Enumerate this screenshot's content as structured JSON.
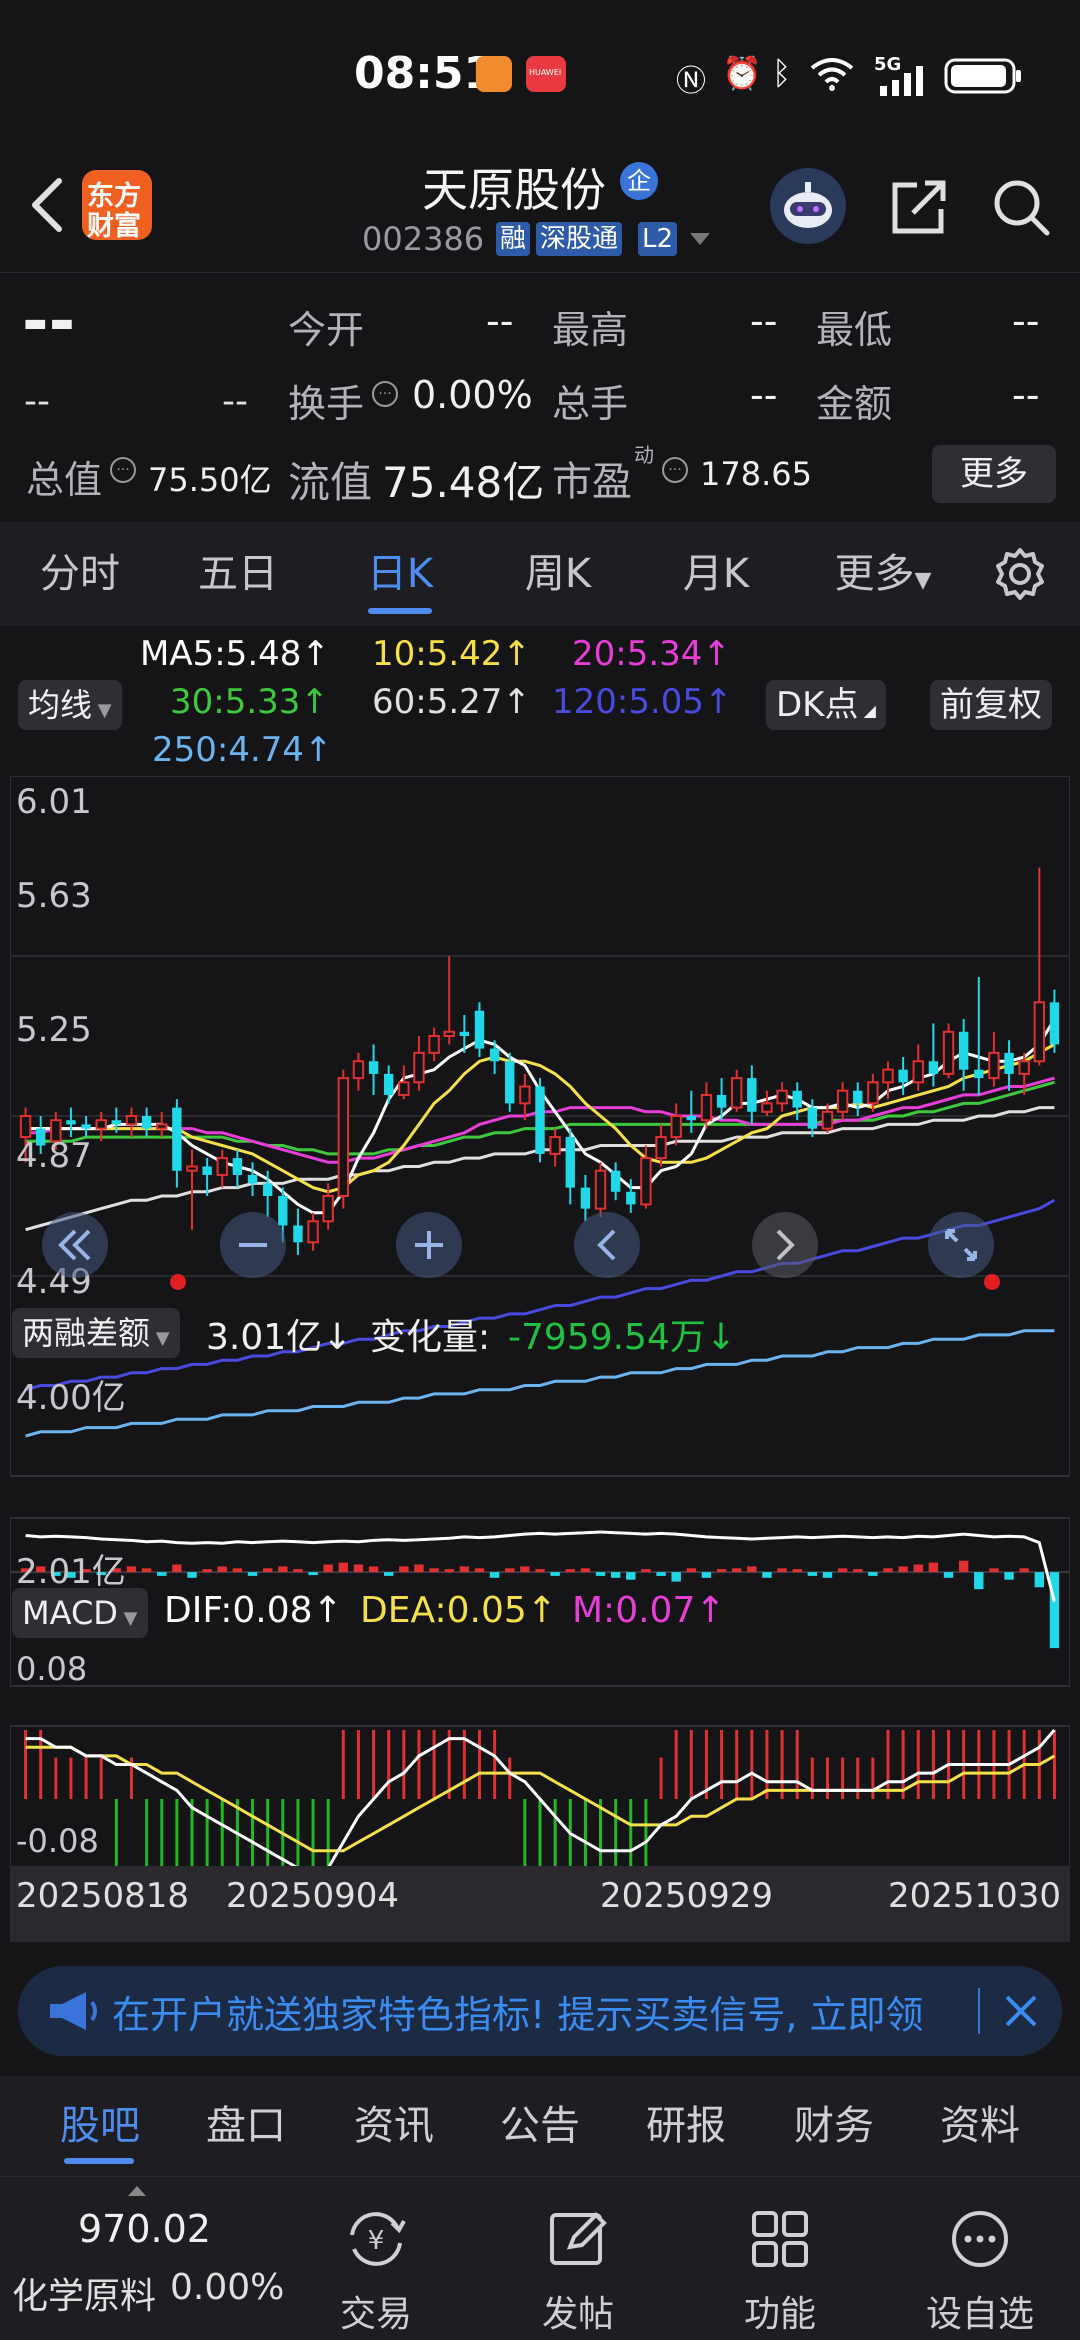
{
  "status_bar": {
    "time": "08:51",
    "network": "5G",
    "huawei_label": "HUAWEI"
  },
  "header": {
    "logo_text_line1": "东方",
    "logo_text_line2": "财富",
    "stock_name": "天原股份",
    "enterprise_badge": "企",
    "stock_code": "002386",
    "badge_margin": "融",
    "badge_connect": "深股通",
    "badge_level": "L2"
  },
  "quote": {
    "price": "--",
    "change": "--",
    "change_pct": "--",
    "open_label": "今开",
    "open_value": "--",
    "high_label": "最高",
    "high_value": "--",
    "low_label": "最低",
    "low_value": "--",
    "turnover_label": "换手",
    "turnover_value": "0.00%",
    "volume_label": "总手",
    "volume_value": "--",
    "amount_label": "金额",
    "amount_value": "--",
    "total_value_label": "总值",
    "total_value": "75.50亿",
    "float_value_label": "流值",
    "float_value": "75.48亿",
    "pe_label": "市盈",
    "pe_sup": "动",
    "pe_value": "178.65",
    "more_button": "更多"
  },
  "period_tabs": [
    "分时",
    "五日",
    "日K",
    "周K",
    "月K",
    "更多"
  ],
  "active_period": 2,
  "indicators": {
    "ma_selector": "均线",
    "ma5": "MA5:5.48",
    "ma10": "10:5.42",
    "ma20": "20:5.34",
    "ma30": "30:5.33",
    "ma60": "60:5.27",
    "ma120": "120:5.05",
    "ma250": "250:4.74",
    "dk_button": "DK点",
    "adjust_button": "前复权",
    "colors": {
      "ma5": "#ffffff",
      "ma10": "#f5e04a",
      "ma20": "#e83ed8",
      "ma30": "#3ec83e",
      "ma60": "#e0e0e0",
      "ma120": "#4a4ae0",
      "ma250": "#6cb4f0",
      "up": "#e03030",
      "down": "#20d8e8"
    }
  },
  "price_axis": {
    "y_max": "6.01",
    "y2": "5.63",
    "y3": "5.25",
    "y4": "4.87",
    "y_min": "4.49"
  },
  "margin_panel": {
    "selector": "两融差额",
    "value": "3.01亿",
    "change_label": "变化量:",
    "change_value": "-7959.54万",
    "axis_top": "4.00亿",
    "axis_bottom": "2.01亿"
  },
  "macd_panel": {
    "selector": "MACD",
    "dif": "DIF:0.08",
    "dea": "DEA:0.05",
    "m": "M:0.07",
    "axis_top": "0.08",
    "axis_bottom": "-0.08"
  },
  "dates": [
    "20250818",
    "20250904",
    "20250929",
    "20251030"
  ],
  "chart_data": {
    "type": "candlestick",
    "ylim": [
      4.49,
      6.01
    ],
    "candles": [
      [
        5.2,
        5.25,
        5.14,
        5.27
      ],
      [
        5.22,
        5.18,
        5.16,
        5.25
      ],
      [
        5.19,
        5.24,
        5.17,
        5.26
      ],
      [
        5.24,
        5.23,
        5.2,
        5.27
      ],
      [
        5.23,
        5.22,
        5.2,
        5.25
      ],
      [
        5.22,
        5.24,
        5.19,
        5.26
      ],
      [
        5.24,
        5.23,
        5.21,
        5.27
      ],
      [
        5.23,
        5.25,
        5.2,
        5.27
      ],
      [
        5.25,
        5.22,
        5.2,
        5.27
      ],
      [
        5.22,
        5.23,
        5.2,
        5.26
      ],
      [
        5.27,
        5.12,
        5.08,
        5.29
      ],
      [
        5.12,
        5.13,
        4.98,
        5.17
      ],
      [
        5.13,
        5.11,
        5.06,
        5.15
      ],
      [
        5.11,
        5.15,
        5.08,
        5.17
      ],
      [
        5.15,
        5.11,
        5.08,
        5.17
      ],
      [
        5.11,
        5.09,
        5.06,
        5.14
      ],
      [
        5.09,
        5.06,
        5.01,
        5.12
      ],
      [
        5.06,
        4.99,
        4.95,
        5.08
      ],
      [
        4.99,
        4.95,
        4.92,
        5.03
      ],
      [
        4.95,
        5.0,
        4.93,
        5.02
      ],
      [
        5.0,
        5.06,
        4.98,
        5.09
      ],
      [
        5.06,
        5.34,
        5.03,
        5.36
      ],
      [
        5.34,
        5.38,
        5.31,
        5.4
      ],
      [
        5.38,
        5.35,
        5.3,
        5.42
      ],
      [
        5.35,
        5.3,
        5.28,
        5.37
      ],
      [
        5.3,
        5.33,
        5.29,
        5.37
      ],
      [
        5.33,
        5.4,
        5.31,
        5.44
      ],
      [
        5.4,
        5.44,
        5.38,
        5.46
      ],
      [
        5.44,
        5.45,
        5.42,
        5.63
      ],
      [
        5.45,
        5.44,
        5.4,
        5.49
      ],
      [
        5.5,
        5.41,
        5.39,
        5.52
      ],
      [
        5.41,
        5.38,
        5.35,
        5.43
      ],
      [
        5.38,
        5.28,
        5.26,
        5.4
      ],
      [
        5.28,
        5.32,
        5.24,
        5.35
      ],
      [
        5.32,
        5.16,
        5.14,
        5.34
      ],
      [
        5.16,
        5.2,
        5.13,
        5.22
      ],
      [
        5.2,
        5.08,
        5.04,
        5.22
      ],
      [
        5.08,
        5.03,
        5.0,
        5.11
      ],
      [
        5.03,
        5.12,
        5.01,
        5.14
      ],
      [
        5.12,
        5.07,
        5.05,
        5.14
      ],
      [
        5.07,
        5.04,
        5.02,
        5.1
      ],
      [
        5.04,
        5.15,
        5.03,
        5.18
      ],
      [
        5.15,
        5.2,
        5.13,
        5.23
      ],
      [
        5.2,
        5.25,
        5.18,
        5.28
      ],
      [
        5.25,
        5.24,
        5.21,
        5.31
      ],
      [
        5.24,
        5.3,
        5.22,
        5.33
      ],
      [
        5.3,
        5.27,
        5.24,
        5.34
      ],
      [
        5.27,
        5.34,
        5.26,
        5.36
      ],
      [
        5.34,
        5.26,
        5.23,
        5.37
      ],
      [
        5.26,
        5.28,
        5.25,
        5.31
      ],
      [
        5.28,
        5.31,
        5.26,
        5.33
      ],
      [
        5.31,
        5.27,
        5.24,
        5.33
      ],
      [
        5.27,
        5.22,
        5.2,
        5.29
      ],
      [
        5.22,
        5.26,
        5.21,
        5.28
      ],
      [
        5.26,
        5.31,
        5.24,
        5.33
      ],
      [
        5.31,
        5.28,
        5.25,
        5.33
      ],
      [
        5.28,
        5.33,
        5.26,
        5.35
      ],
      [
        5.33,
        5.36,
        5.29,
        5.38
      ],
      [
        5.36,
        5.33,
        5.3,
        5.39
      ],
      [
        5.33,
        5.38,
        5.31,
        5.42
      ],
      [
        5.38,
        5.35,
        5.32,
        5.47
      ],
      [
        5.35,
        5.45,
        5.34,
        5.47
      ],
      [
        5.45,
        5.36,
        5.31,
        5.48
      ],
      [
        5.36,
        5.34,
        5.3,
        5.58
      ],
      [
        5.34,
        5.4,
        5.32,
        5.45
      ],
      [
        5.4,
        5.35,
        5.31,
        5.43
      ],
      [
        5.35,
        5.38,
        5.3,
        5.4
      ],
      [
        5.38,
        5.52,
        5.37,
        5.84
      ],
      [
        5.52,
        5.42,
        5.4,
        5.55
      ]
    ],
    "ma": {
      "ma5": [
        5.22,
        5.22,
        5.22,
        5.22,
        5.22,
        5.22,
        5.23,
        5.23,
        5.23,
        5.23,
        5.21,
        5.18,
        5.16,
        5.14,
        5.13,
        5.12,
        5.1,
        5.07,
        5.04,
        5.02,
        5.02,
        5.07,
        5.15,
        5.21,
        5.29,
        5.34,
        5.35,
        5.36,
        5.39,
        5.41,
        5.43,
        5.42,
        5.39,
        5.37,
        5.31,
        5.26,
        5.21,
        5.16,
        5.14,
        5.11,
        5.08,
        5.08,
        5.12,
        5.13,
        5.16,
        5.23,
        5.25,
        5.28,
        5.28,
        5.29,
        5.3,
        5.29,
        5.27,
        5.27,
        5.28,
        5.27,
        5.28,
        5.31,
        5.32,
        5.34,
        5.35,
        5.38,
        5.4,
        5.39,
        5.38,
        5.38,
        5.39,
        5.42,
        5.48
      ],
      "ma10": [
        5.22,
        5.22,
        5.22,
        5.22,
        5.22,
        5.22,
        5.22,
        5.22,
        5.22,
        5.22,
        5.22,
        5.2,
        5.19,
        5.18,
        5.17,
        5.16,
        5.14,
        5.12,
        5.1,
        5.08,
        5.07,
        5.08,
        5.11,
        5.12,
        5.14,
        5.18,
        5.23,
        5.28,
        5.31,
        5.35,
        5.38,
        5.39,
        5.38,
        5.38,
        5.37,
        5.35,
        5.32,
        5.28,
        5.25,
        5.22,
        5.18,
        5.15,
        5.14,
        5.14,
        5.14,
        5.15,
        5.17,
        5.19,
        5.21,
        5.22,
        5.25,
        5.26,
        5.27,
        5.27,
        5.27,
        5.28,
        5.27,
        5.28,
        5.29,
        5.3,
        5.31,
        5.32,
        5.34,
        5.35,
        5.36,
        5.37,
        5.38,
        5.4,
        5.42
      ],
      "ma20": [
        5.21,
        5.21,
        5.22,
        5.22,
        5.22,
        5.22,
        5.22,
        5.22,
        5.22,
        5.22,
        5.22,
        5.22,
        5.21,
        5.21,
        5.2,
        5.19,
        5.18,
        5.17,
        5.16,
        5.15,
        5.14,
        5.14,
        5.15,
        5.15,
        5.16,
        5.17,
        5.18,
        5.19,
        5.2,
        5.21,
        5.23,
        5.24,
        5.25,
        5.25,
        5.26,
        5.26,
        5.27,
        5.27,
        5.27,
        5.27,
        5.27,
        5.26,
        5.26,
        5.25,
        5.25,
        5.25,
        5.24,
        5.24,
        5.23,
        5.23,
        5.23,
        5.23,
        5.23,
        5.23,
        5.24,
        5.24,
        5.25,
        5.26,
        5.27,
        5.27,
        5.28,
        5.29,
        5.3,
        5.3,
        5.31,
        5.32,
        5.32,
        5.33,
        5.34
      ],
      "ma30": [
        5.19,
        5.19,
        5.19,
        5.19,
        5.2,
        5.2,
        5.2,
        5.2,
        5.2,
        5.2,
        5.2,
        5.2,
        5.2,
        5.2,
        5.19,
        5.19,
        5.18,
        5.18,
        5.17,
        5.17,
        5.16,
        5.16,
        5.16,
        5.16,
        5.17,
        5.17,
        5.18,
        5.18,
        5.19,
        5.2,
        5.2,
        5.21,
        5.21,
        5.22,
        5.22,
        5.22,
        5.23,
        5.23,
        5.23,
        5.23,
        5.23,
        5.23,
        5.23,
        5.23,
        5.23,
        5.23,
        5.23,
        5.23,
        5.23,
        5.23,
        5.23,
        5.23,
        5.23,
        5.24,
        5.24,
        5.24,
        5.24,
        5.25,
        5.25,
        5.26,
        5.26,
        5.27,
        5.28,
        5.28,
        5.29,
        5.3,
        5.31,
        5.32,
        5.33
      ],
      "ma60": [
        4.98,
        4.99,
        5.0,
        5.01,
        5.02,
        5.03,
        5.04,
        5.05,
        5.05,
        5.06,
        5.06,
        5.07,
        5.07,
        5.08,
        5.08,
        5.09,
        5.09,
        5.09,
        5.1,
        5.1,
        5.1,
        5.11,
        5.11,
        5.12,
        5.12,
        5.13,
        5.13,
        5.14,
        5.14,
        5.15,
        5.15,
        5.16,
        5.16,
        5.16,
        5.17,
        5.17,
        5.17,
        5.17,
        5.18,
        5.18,
        5.18,
        5.18,
        5.18,
        5.19,
        5.19,
        5.19,
        5.19,
        5.2,
        5.2,
        5.2,
        5.21,
        5.21,
        5.21,
        5.21,
        5.22,
        5.22,
        5.22,
        5.23,
        5.23,
        5.23,
        5.24,
        5.24,
        5.24,
        5.25,
        5.25,
        5.26,
        5.26,
        5.27,
        5.27
      ],
      "ma120": [
        4.6,
        4.61,
        4.61,
        4.62,
        4.62,
        4.63,
        4.63,
        4.64,
        4.64,
        4.65,
        4.65,
        4.66,
        4.66,
        4.67,
        4.67,
        4.68,
        4.68,
        4.69,
        4.69,
        4.7,
        4.71,
        4.71,
        4.72,
        4.72,
        4.73,
        4.74,
        4.74,
        4.75,
        4.75,
        4.76,
        4.77,
        4.77,
        4.78,
        4.78,
        4.79,
        4.8,
        4.8,
        4.81,
        4.82,
        4.82,
        4.83,
        4.84,
        4.84,
        4.85,
        4.86,
        4.86,
        4.87,
        4.88,
        4.88,
        4.89,
        4.9,
        4.9,
        4.91,
        4.92,
        4.93,
        4.93,
        4.94,
        4.95,
        4.96,
        4.96,
        4.97,
        4.98,
        4.99,
        4.99,
        5.0,
        5.01,
        5.02,
        5.03,
        5.05
      ],
      "ma250": [
        4.49,
        4.5,
        4.5,
        4.5,
        4.51,
        4.51,
        4.51,
        4.52,
        4.52,
        4.52,
        4.53,
        4.53,
        4.53,
        4.54,
        4.54,
        4.54,
        4.55,
        4.55,
        4.55,
        4.56,
        4.56,
        4.56,
        4.57,
        4.57,
        4.57,
        4.58,
        4.58,
        4.59,
        4.59,
        4.59,
        4.6,
        4.6,
        4.6,
        4.61,
        4.61,
        4.62,
        4.62,
        4.62,
        4.63,
        4.63,
        4.64,
        4.64,
        4.64,
        4.65,
        4.65,
        4.66,
        4.66,
        4.66,
        4.67,
        4.67,
        4.68,
        4.68,
        4.68,
        4.69,
        4.69,
        4.7,
        4.7,
        4.7,
        4.71,
        4.71,
        4.72,
        4.72,
        4.72,
        4.73,
        4.73,
        4.73,
        4.74,
        4.74,
        4.74
      ]
    },
    "margin_balance_line": [
      3.95,
      3.93,
      3.94,
      3.93,
      3.92,
      3.9,
      3.89,
      3.88,
      3.86,
      3.87,
      3.85,
      3.84,
      3.85,
      3.84,
      3.86,
      3.85,
      3.86,
      3.87,
      3.86,
      3.85,
      3.86,
      3.87,
      3.86,
      3.88,
      3.89,
      3.88,
      3.89,
      3.9,
      3.91,
      3.93,
      3.92,
      3.93,
      3.95,
      3.97,
      3.98,
      3.97,
      3.98,
      3.99,
      4.0,
      3.99,
      3.98,
      3.97,
      3.98,
      3.97,
      3.95,
      3.93,
      3.92,
      3.91,
      3.9,
      3.91,
      3.92,
      3.93,
      3.92,
      3.93,
      3.94,
      3.93,
      3.92,
      3.93,
      3.92,
      3.94,
      3.93,
      3.95,
      3.97,
      3.95,
      3.93,
      3.94,
      3.93,
      3.85,
      3.01
    ],
    "margin_bars": [
      0.02,
      0.03,
      -0.02,
      -0.03,
      0.01,
      -0.01,
      0.02,
      0.03,
      0.02,
      -0.02,
      0.04,
      -0.03,
      0.01,
      0.03,
      0.02,
      -0.02,
      0.02,
      0.03,
      0.01,
      -0.01,
      0.04,
      0.05,
      0.04,
      0.03,
      -0.02,
      0.03,
      0.04,
      0.02,
      0.01,
      0.03,
      0.02,
      -0.03,
      0.02,
      0.03,
      0.01,
      -0.02,
      0.01,
      0.02,
      -0.02,
      -0.03,
      -0.04,
      0.01,
      -0.02,
      -0.05,
      0.02,
      -0.03,
      0.01,
      0.02,
      0.03,
      -0.03,
      0.02,
      0.01,
      -0.02,
      -0.03,
      0.02,
      0.01,
      -0.02,
      0.02,
      0.03,
      0.04,
      0.05,
      -0.03,
      0.06,
      -0.09,
      0.02,
      -0.04,
      0.02,
      -0.08,
      -0.4
    ],
    "margin_ylim": [
      2.01,
      4.0
    ],
    "macd_dif": [
      0.07,
      0.07,
      0.06,
      0.06,
      0.05,
      0.05,
      0.04,
      0.04,
      0.03,
      0.02,
      0.01,
      -0.01,
      -0.02,
      -0.03,
      -0.04,
      -0.05,
      -0.06,
      -0.07,
      -0.08,
      -0.09,
      -0.08,
      -0.05,
      -0.02,
      0.0,
      0.02,
      0.03,
      0.05,
      0.06,
      0.07,
      0.07,
      0.06,
      0.05,
      0.03,
      0.02,
      0.0,
      -0.02,
      -0.04,
      -0.05,
      -0.06,
      -0.06,
      -0.06,
      -0.05,
      -0.03,
      -0.02,
      0.0,
      0.01,
      0.02,
      0.02,
      0.03,
      0.02,
      0.02,
      0.02,
      0.01,
      0.01,
      0.01,
      0.01,
      0.01,
      0.02,
      0.02,
      0.03,
      0.03,
      0.04,
      0.04,
      0.04,
      0.04,
      0.04,
      0.05,
      0.06,
      0.08
    ],
    "macd_dea": [
      0.06,
      0.06,
      0.06,
      0.06,
      0.05,
      0.05,
      0.05,
      0.04,
      0.04,
      0.03,
      0.03,
      0.02,
      0.01,
      0.0,
      -0.01,
      -0.02,
      -0.03,
      -0.04,
      -0.05,
      -0.06,
      -0.06,
      -0.06,
      -0.05,
      -0.04,
      -0.03,
      -0.02,
      -0.01,
      0.0,
      0.01,
      0.02,
      0.03,
      0.03,
      0.03,
      0.03,
      0.03,
      0.02,
      0.01,
      0.0,
      -0.01,
      -0.02,
      -0.03,
      -0.03,
      -0.03,
      -0.03,
      -0.02,
      -0.02,
      -0.01,
      0.0,
      0.0,
      0.01,
      0.01,
      0.01,
      0.01,
      0.01,
      0.01,
      0.01,
      0.01,
      0.01,
      0.01,
      0.02,
      0.02,
      0.02,
      0.03,
      0.03,
      0.03,
      0.03,
      0.04,
      0.04,
      0.05
    ],
    "macd_ylim": [
      -0.08,
      0.08
    ]
  },
  "banner": {
    "text": "在开户就送独家特色指标! 提示买卖信号, 立即领"
  },
  "bottom_tabs": [
    "股吧",
    "盘口",
    "资讯",
    "公告",
    "研报",
    "财务",
    "资料"
  ],
  "active_bottom_tab": 0,
  "index_info": {
    "value": "970.02",
    "name": "化学原料",
    "change": "0.00%"
  },
  "bottom_actions": [
    "交易",
    "发帖",
    "功能",
    "设自选"
  ]
}
